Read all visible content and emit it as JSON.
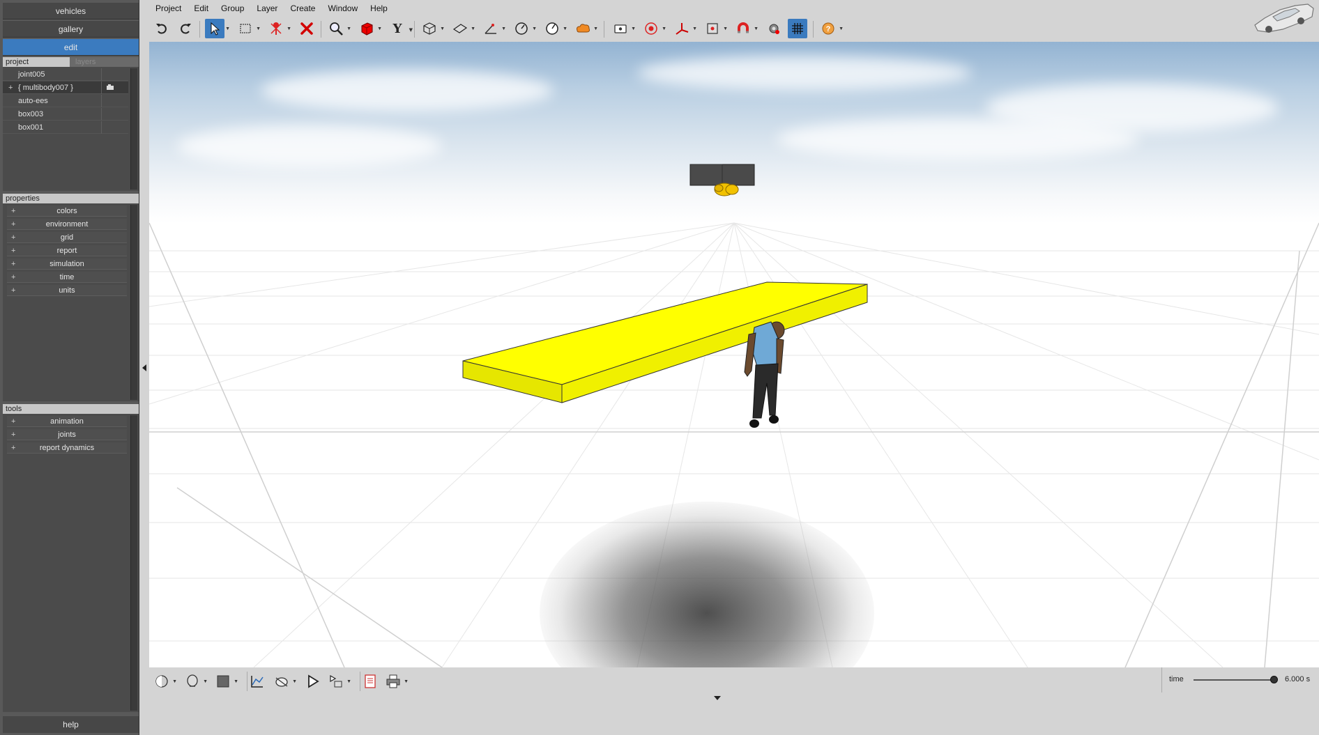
{
  "left_nav": {
    "vehicles": "vehicles",
    "gallery": "gallery",
    "edit": "edit",
    "help": "help"
  },
  "project_panel": {
    "tab_project": "project",
    "tab_layers": "layers",
    "items": [
      {
        "label": "joint005",
        "expander": ""
      },
      {
        "label": "{ multibody007 }",
        "expander": "+"
      },
      {
        "label": "auto-ees",
        "expander": ""
      },
      {
        "label": "box003",
        "expander": ""
      },
      {
        "label": "box001",
        "expander": ""
      }
    ]
  },
  "properties_panel": {
    "title": "properties",
    "items": [
      "colors",
      "environment",
      "grid",
      "report",
      "simulation",
      "time",
      "units"
    ]
  },
  "tools_panel": {
    "title": "tools",
    "items": [
      "animation",
      "joints",
      "report dynamics"
    ]
  },
  "menu": [
    "Project",
    "Edit",
    "Group",
    "Layer",
    "Create",
    "Window",
    "Help"
  ],
  "toolbar_icons": [
    "undo-icon",
    "redo-icon",
    "select-arrow-icon",
    "selection-box-icon",
    "pin-icon",
    "delete-icon",
    "zoom-icon",
    "red-cube-icon",
    "y-axis-icon",
    "box-wireframe-icon",
    "plane-icon",
    "axis-tool-icon",
    "gauge-icon",
    "clock-gauge-icon",
    "cloud-tool-icon",
    "camera-icon",
    "target-icon",
    "triad-icon",
    "film-icon",
    "magnet-icon",
    "gear-icon",
    "grid-icon",
    "help-icon"
  ],
  "time": {
    "label": "time",
    "value": "6.000 s",
    "fraction": 0.96
  },
  "colors": {
    "accent": "#3b7bbf",
    "panel_bg": "#595959",
    "box_yellow": "#ffff00"
  }
}
